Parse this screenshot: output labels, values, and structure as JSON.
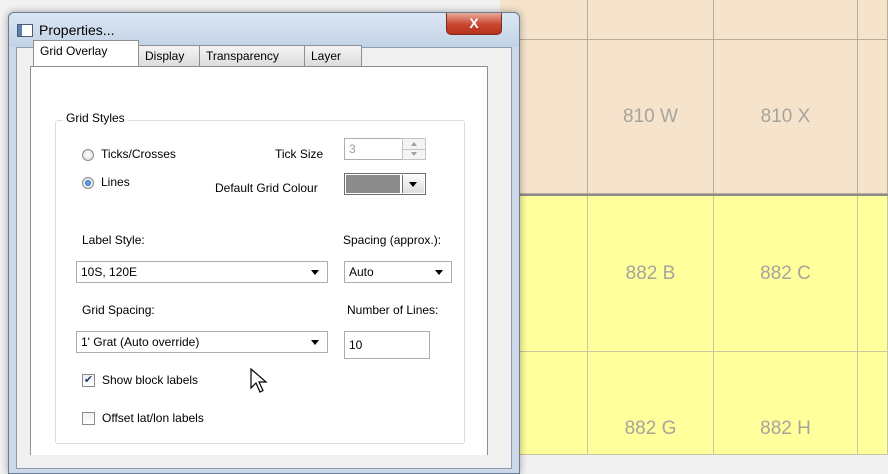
{
  "window": {
    "title": "Properties...",
    "close_glyph": "X"
  },
  "tabs": [
    {
      "label": "Grid Overlay",
      "active": true
    },
    {
      "label": "Display"
    },
    {
      "label": "Transparency"
    },
    {
      "label": "Layer"
    }
  ],
  "grid_styles": {
    "group_label": "Grid Styles",
    "radio_ticks_label": "Ticks/Crosses",
    "radio_lines_label": "Lines",
    "selected": "Lines",
    "tick_size_label": "Tick Size",
    "tick_size_value": "3",
    "default_colour_label": "Default Grid Colour",
    "default_colour": "#8c8c8c",
    "label_style_label": "Label Style:",
    "label_style_value": "10S, 120E",
    "spacing_label": "Spacing (approx.):",
    "spacing_value": "Auto",
    "grid_spacing_label": "Grid Spacing:",
    "grid_spacing_value": "1' Grat (Auto override)",
    "number_of_lines_label": "Number of Lines:",
    "number_of_lines_value": "10",
    "show_block_labels_label": "Show block labels",
    "show_block_labels_checked": true,
    "offset_latlon_label": "Offset lat/lon labels",
    "offset_latlon_checked": false
  },
  "map": {
    "cells": [
      {
        "label": "810 W"
      },
      {
        "label": "810 X"
      },
      {
        "label": "882 B"
      },
      {
        "label": "882 C"
      },
      {
        "label": "882 G"
      },
      {
        "label": "882 H"
      }
    ],
    "colors": {
      "tan": "#f5e3cb",
      "yellow": "#ffff9c"
    }
  },
  "icons": {
    "window_icon": "window-icon",
    "close": "close-icon",
    "cursor": "mouse-pointer-icon"
  }
}
